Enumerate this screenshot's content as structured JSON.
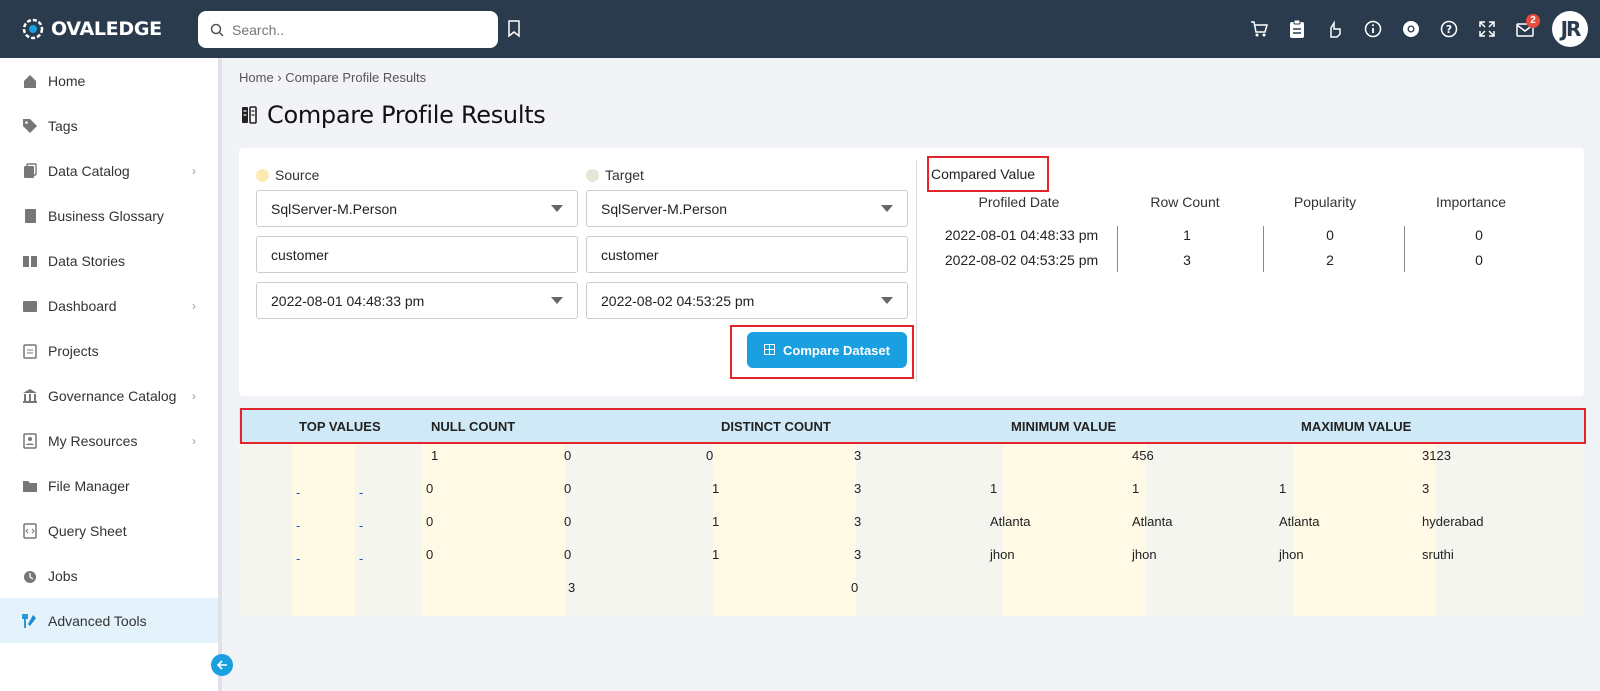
{
  "app": {
    "logo_text": "OVALEDGE",
    "user_initials": "JR",
    "notification_count": "2"
  },
  "search": {
    "placeholder": "Search.."
  },
  "sidebar": {
    "items": [
      {
        "label": "Home",
        "icon": "home-icon",
        "chevron": false
      },
      {
        "label": "Tags",
        "icon": "tag-icon",
        "chevron": false
      },
      {
        "label": "Data Catalog",
        "icon": "data-catalog-icon",
        "chevron": true
      },
      {
        "label": "Business Glossary",
        "icon": "book-icon",
        "chevron": false
      },
      {
        "label": "Data Stories",
        "icon": "open-book-icon",
        "chevron": false
      },
      {
        "label": "Dashboard",
        "icon": "dashboard-icon",
        "chevron": true
      },
      {
        "label": "Projects",
        "icon": "clipboard-icon",
        "chevron": false
      },
      {
        "label": "Governance Catalog",
        "icon": "bank-icon",
        "chevron": true
      },
      {
        "label": "My Resources",
        "icon": "resources-icon",
        "chevron": true
      },
      {
        "label": "File Manager",
        "icon": "folder-icon",
        "chevron": false
      },
      {
        "label": "Query Sheet",
        "icon": "query-sheet-icon",
        "chevron": false
      },
      {
        "label": "Jobs",
        "icon": "jobs-icon",
        "chevron": false
      },
      {
        "label": "Advanced Tools",
        "icon": "tools-icon",
        "chevron": false,
        "active": true
      }
    ]
  },
  "breadcrumb": {
    "home": "Home",
    "separator": "›",
    "current": "Compare Profile Results"
  },
  "page": {
    "title": "Compare Profile Results"
  },
  "compare_form": {
    "source_label": "Source",
    "target_label": "Target",
    "source_connection": "SqlServer-M.Person",
    "target_connection": "SqlServer-M.Person",
    "source_table": "customer",
    "target_table": "customer",
    "source_date": "2022-08-01 04:48:33 pm",
    "target_date": "2022-08-02 04:53:25 pm",
    "compare_button": "Compare Dataset",
    "source_color": "#fdeab3",
    "target_color": "#e3e8d6"
  },
  "compared_value": {
    "title": "Compared Value",
    "headers": [
      "Profiled Date",
      "Row Count",
      "Popularity",
      "Importance"
    ],
    "rows": [
      {
        "date": "2022-08-01 04:48:33 pm",
        "row_count": "1",
        "popularity": "0",
        "importance": "0"
      },
      {
        "date": "2022-08-02 04:53:25 pm",
        "row_count": "3",
        "popularity": "2",
        "importance": "0"
      }
    ]
  },
  "profile_table": {
    "headers": [
      "TOP VALUES",
      "NULL COUNT",
      "DISTINCT COUNT",
      "MINIMUM VALUE",
      "MAXIMUM VALUE"
    ],
    "rows": [
      {
        "tv_a": "",
        "tv_b": "",
        "null_a": "1",
        "null_b": "0",
        "dist_a": "0",
        "dist_b": "3",
        "min_a": "",
        "min_b": "456",
        "max_a": "",
        "max_b": "3123"
      },
      {
        "tv_a": "-",
        "tv_b": "-",
        "null_a": "0",
        "null_b": "0",
        "dist_a": "1",
        "dist_b": "3",
        "min_a": "1",
        "min_b": "1",
        "max_a": "1",
        "max_b": "3"
      },
      {
        "tv_a": "-",
        "tv_b": "-",
        "null_a": "0",
        "null_b": "0",
        "dist_a": "1",
        "dist_b": "3",
        "min_a": "Atlanta",
        "min_b": "Atlanta",
        "max_a": "Atlanta",
        "max_b": "hyderabad"
      },
      {
        "tv_a": "-",
        "tv_b": "-",
        "null_a": "0",
        "null_b": "0",
        "dist_a": "1",
        "dist_b": "3",
        "min_a": "jhon",
        "min_b": "jhon",
        "max_a": "jhon",
        "max_b": "sruthi"
      },
      {
        "tv_a": "",
        "tv_b": "",
        "null_a": "",
        "null_b": "3",
        "dist_a": "",
        "dist_b": "0",
        "min_a": "",
        "min_b": "",
        "max_a": "",
        "max_b": ""
      }
    ]
  },
  "colors": {
    "topbar": "#2a3b4d",
    "accent": "#1aa0e0",
    "highlight": "#e0262b"
  }
}
